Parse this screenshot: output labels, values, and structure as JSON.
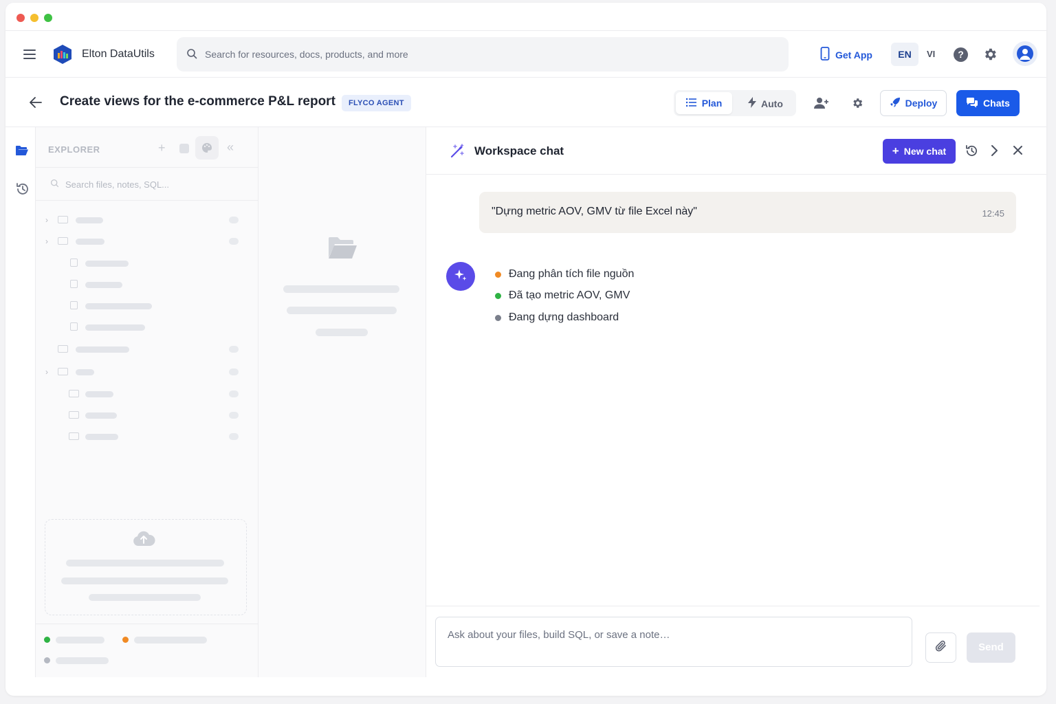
{
  "app": {
    "brand": "Elton DataUtils"
  },
  "search": {
    "placeholder": "Search for resources, docs, products, and more"
  },
  "topnav": {
    "get_app": "Get App",
    "lang_en": "EN",
    "lang_vi": "VI",
    "help": "?"
  },
  "page": {
    "title": "Create views for the e-commerce P&L report",
    "badge": "FLYCO AGENT",
    "modes": {
      "plan": "Plan",
      "auto": "Auto"
    },
    "deploy": "Deploy",
    "chats": "Chats"
  },
  "explorer": {
    "title": "EXPLORER",
    "search_placeholder": "Search files, notes, SQL..."
  },
  "chat": {
    "title": "Workspace chat",
    "new_chat": "New chat",
    "user_message": "\"Dựng metric AOV, GMV từ file Excel này\"",
    "user_time": "12:45",
    "steps": [
      {
        "label": "Đang phân tích file nguồn",
        "color": "#f08a24"
      },
      {
        "label": "Đã tạo metric AOV, GMV",
        "color": "#2fb344"
      },
      {
        "label": "Đang dựng dashboard",
        "color": "#7a7f8b"
      }
    ],
    "composer_placeholder": "Ask about your files, build SQL, or save a note…",
    "send": "Send"
  },
  "colors": {
    "primary": "#1a5ae8",
    "new_chat": "#4a3fe0",
    "bot": "#5a4be8"
  }
}
